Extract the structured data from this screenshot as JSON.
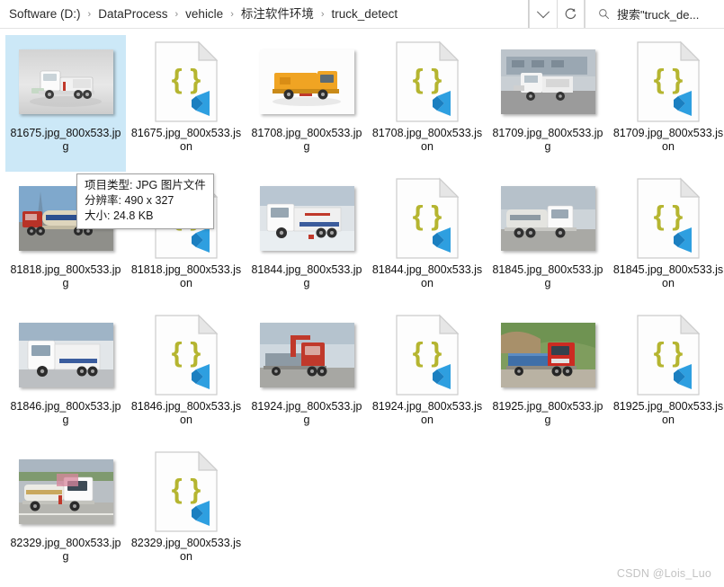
{
  "window": {
    "type": "file-explorer-grid"
  },
  "addressbar": {
    "breadcrumbs": [
      "Software (D:)",
      "DataProcess",
      "vehicle",
      "标注软件环境",
      "truck_detect"
    ],
    "separator": "›",
    "dropdown_icon": "chevron-down-icon",
    "refresh_icon": "refresh-icon",
    "refresh_glyph": "↻"
  },
  "search": {
    "icon": "search-icon",
    "placeholder": "搜索\"truck_de...",
    "value": ""
  },
  "colors": {
    "selection": "#cce8f7",
    "json_brace": "#b5b530",
    "vscode_blue": "#2e9fe0",
    "text": "#111111",
    "watermark": "#c3c3c3"
  },
  "files": [
    {
      "name": "81675.jpg_800x533.jpg",
      "kind": "jpg",
      "selected": true,
      "thumb": "white-sweeper-truck-studio"
    },
    {
      "name": "81675.jpg_800x533.json",
      "kind": "json",
      "selected": false,
      "thumb": "json-file-icon"
    },
    {
      "name": "81708.jpg_800x533.jpg",
      "kind": "jpg",
      "selected": false,
      "thumb": "orange-sweeper-truck-studio"
    },
    {
      "name": "81708.jpg_800x533.json",
      "kind": "json",
      "selected": false,
      "thumb": "json-file-icon"
    },
    {
      "name": "81709.jpg_800x533.jpg",
      "kind": "jpg",
      "selected": false,
      "thumb": "white-truck-grey-building"
    },
    {
      "name": "81709.jpg_800x533.json",
      "kind": "json",
      "selected": false,
      "thumb": "json-file-icon"
    },
    {
      "name": "81818.jpg_800x533.jpg",
      "kind": "jpg",
      "selected": false,
      "thumb": "red-cab-cream-tanker-blue-sky"
    },
    {
      "name": "81818.jpg_800x533.json",
      "kind": "json",
      "selected": false,
      "thumb": "json-file-icon"
    },
    {
      "name": "81844.jpg_800x533.jpg",
      "kind": "jpg",
      "selected": false,
      "thumb": "white-truck-snow-yard"
    },
    {
      "name": "81844.jpg_800x533.json",
      "kind": "json",
      "selected": false,
      "thumb": "json-file-icon"
    },
    {
      "name": "81845.jpg_800x533.jpg",
      "kind": "jpg",
      "selected": false,
      "thumb": "white-tanker-truck-outdoor"
    },
    {
      "name": "81845.jpg_800x533.json",
      "kind": "json",
      "selected": false,
      "thumb": "json-file-icon"
    },
    {
      "name": "81846.jpg_800x533.jpg",
      "kind": "jpg",
      "selected": false,
      "thumb": "white-truck-showroom"
    },
    {
      "name": "81846.jpg_800x533.json",
      "kind": "json",
      "selected": false,
      "thumb": "json-file-icon"
    },
    {
      "name": "81924.jpg_800x533.jpg",
      "kind": "jpg",
      "selected": false,
      "thumb": "red-crane-truck-road"
    },
    {
      "name": "81924.jpg_800x533.json",
      "kind": "json",
      "selected": false,
      "thumb": "json-file-icon"
    },
    {
      "name": "81925.jpg_800x533.jpg",
      "kind": "jpg",
      "selected": false,
      "thumb": "red-truck-blue-flatbed-hillside"
    },
    {
      "name": "81925.jpg_800x533.json",
      "kind": "json",
      "selected": false,
      "thumb": "json-file-icon"
    },
    {
      "name": "82329.jpg_800x533.jpg",
      "kind": "jpg",
      "selected": false,
      "thumb": "white-fuel-tanker-truck-road"
    },
    {
      "name": "82329.jpg_800x533.json",
      "kind": "json",
      "selected": false,
      "thumb": "json-file-icon"
    }
  ],
  "tooltip": {
    "lines": [
      "项目类型: JPG 图片文件",
      "分辨率: 490 x 327",
      "大小: 24.8 KB"
    ],
    "line1": "项目类型: JPG 图片文件",
    "line2": "分辨率: 490 x 327",
    "line3": "大小: 24.8 KB"
  },
  "watermark": {
    "text": "CSDN @Lois_Luo"
  }
}
